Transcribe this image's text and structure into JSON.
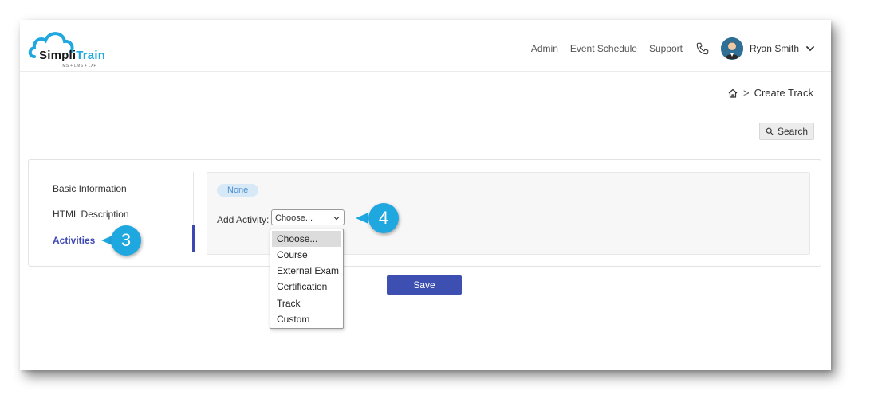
{
  "brand": {
    "logo_main": "Simpli",
    "logo_accent": "Train",
    "tagline": "TMS + LMS + LXP"
  },
  "header": {
    "nav": [
      {
        "label": "Admin"
      },
      {
        "label": "Event Schedule"
      },
      {
        "label": "Support"
      }
    ],
    "user_name": "Ryan Smith",
    "icons": [
      "phone-icon",
      "avatar",
      "chevron-down-icon"
    ]
  },
  "breadcrumb": {
    "current": "Create Track",
    "separator": ">"
  },
  "search": {
    "label": "Search"
  },
  "sidebar": {
    "items": [
      {
        "label": "Basic Information",
        "active": false
      },
      {
        "label": "HTML Description",
        "active": false
      },
      {
        "label": "Activities",
        "active": true
      }
    ]
  },
  "activities": {
    "pill": "None",
    "add_label": "Add Activity:",
    "select_value": "Choose...",
    "options": [
      "Choose...",
      "Course",
      "External Exam",
      "Certification",
      "Track",
      "Custom"
    ]
  },
  "save_label": "Save",
  "callouts": {
    "step_sidebar": "3",
    "step_select": "4"
  },
  "colors": {
    "accent": "#3d47b3",
    "callout": "#1fa7e0",
    "brand": "#1fa8e0",
    "save": "#3d4fb0",
    "pill_bg": "#d7e9f7"
  }
}
